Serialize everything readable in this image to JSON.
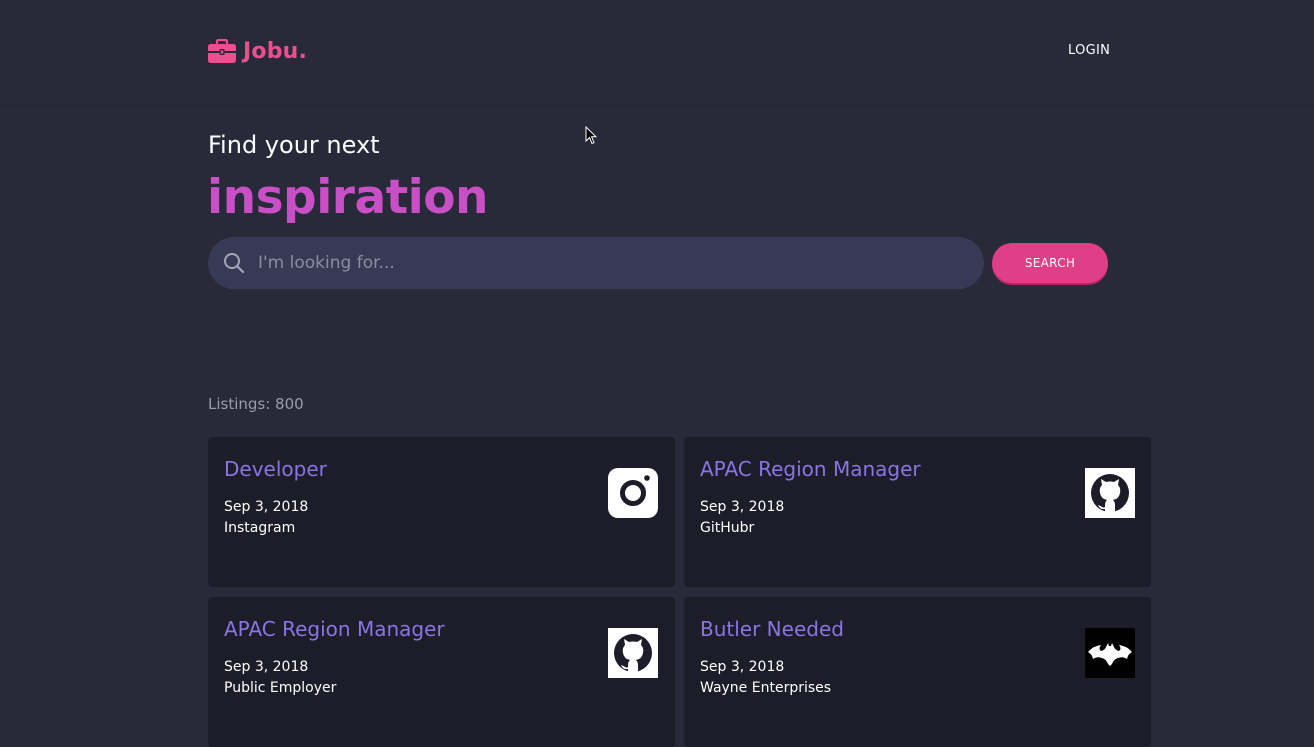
{
  "header": {
    "logo_text": "Jobu.",
    "login_label": "LOGIN"
  },
  "hero": {
    "line1": "Find your next",
    "line2": "inspiration"
  },
  "search": {
    "placeholder": "I'm looking for...",
    "value": "",
    "button_label": "SEARCH"
  },
  "listings": {
    "count_text": "Listings: 800",
    "items": [
      {
        "title": "Developer",
        "date": "Sep 3, 2018",
        "company": "Instagram",
        "logo": "instagram-icon"
      },
      {
        "title": "APAC Region Manager",
        "date": "Sep 3, 2018",
        "company": "GitHubr",
        "logo": "github-icon"
      },
      {
        "title": "APAC Region Manager",
        "date": "Sep 3, 2018",
        "company": "Public Employer",
        "logo": "github-icon"
      },
      {
        "title": "Butler Needed",
        "date": "Sep 3, 2018",
        "company": "Wayne Enterprises",
        "logo": "batman-icon"
      }
    ]
  },
  "colors": {
    "background": "#282a3a",
    "brand_pink": "#ec4e8e",
    "hero_purple": "#c84fc5",
    "card_background": "#1d1d29",
    "card_title": "#8b74e3",
    "search_button": "#de3f86"
  }
}
